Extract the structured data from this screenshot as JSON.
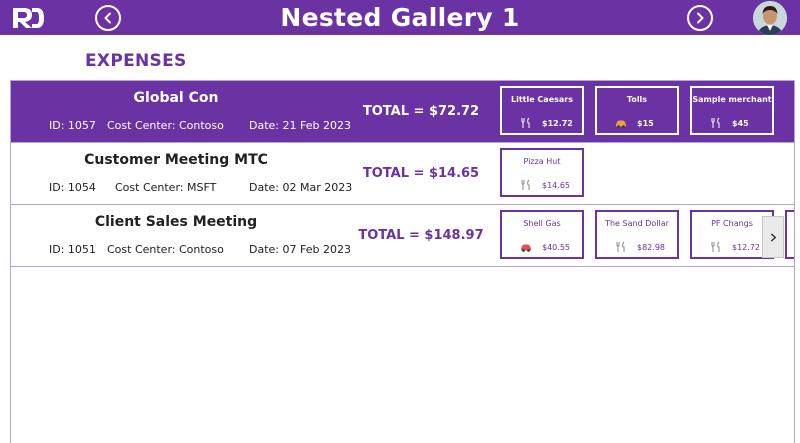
{
  "header": {
    "title": "Nested Gallery 1",
    "logo_text": "RD",
    "colors": {
      "primary": "#6B32A3",
      "text_on_primary": "#FFFFFF"
    },
    "icons": {
      "prev": "chevron-left-icon",
      "next": "chevron-right-icon"
    }
  },
  "section": {
    "title": "EXPENSES"
  },
  "rows": [
    {
      "title": "Global Con",
      "id": "ID: 1057",
      "cost_center": "Cost Center: Contoso",
      "date": "Date: 21 Feb 2023",
      "total": "TOTAL = $72.72",
      "selected": true,
      "items": [
        {
          "merchant": "Little Caesars",
          "icon": "utensils-icon",
          "amount": "$12.72"
        },
        {
          "merchant": "Tolls",
          "icon": "car-icon",
          "amount": "$15"
        },
        {
          "merchant": "Sample merchant",
          "icon": "utensils-icon",
          "amount": "$45"
        }
      ]
    },
    {
      "title": "Customer Meeting MTC",
      "id": "ID: 1054",
      "cost_center": "Cost Center: MSFT",
      "date": "Date: 02 Mar 2023",
      "total": "TOTAL = $14.65",
      "selected": false,
      "items": [
        {
          "merchant": "Pizza Hut",
          "icon": "utensils-icon",
          "amount": "$14.65"
        }
      ]
    },
    {
      "title": "Client Sales Meeting",
      "id": "ID: 1051",
      "cost_center": "Cost Center: Contoso",
      "date": "Date: 07 Feb 2023",
      "total": "TOTAL = $148.97",
      "selected": false,
      "items": [
        {
          "merchant": "Shell Gas",
          "icon": "car-icon",
          "amount": "$40.55"
        },
        {
          "merchant": "The Sand Dollar",
          "icon": "utensils-icon",
          "amount": "$82.98"
        },
        {
          "merchant": "PF Changs",
          "icon": "utensils-icon",
          "amount": "$12.72"
        }
      ]
    }
  ]
}
